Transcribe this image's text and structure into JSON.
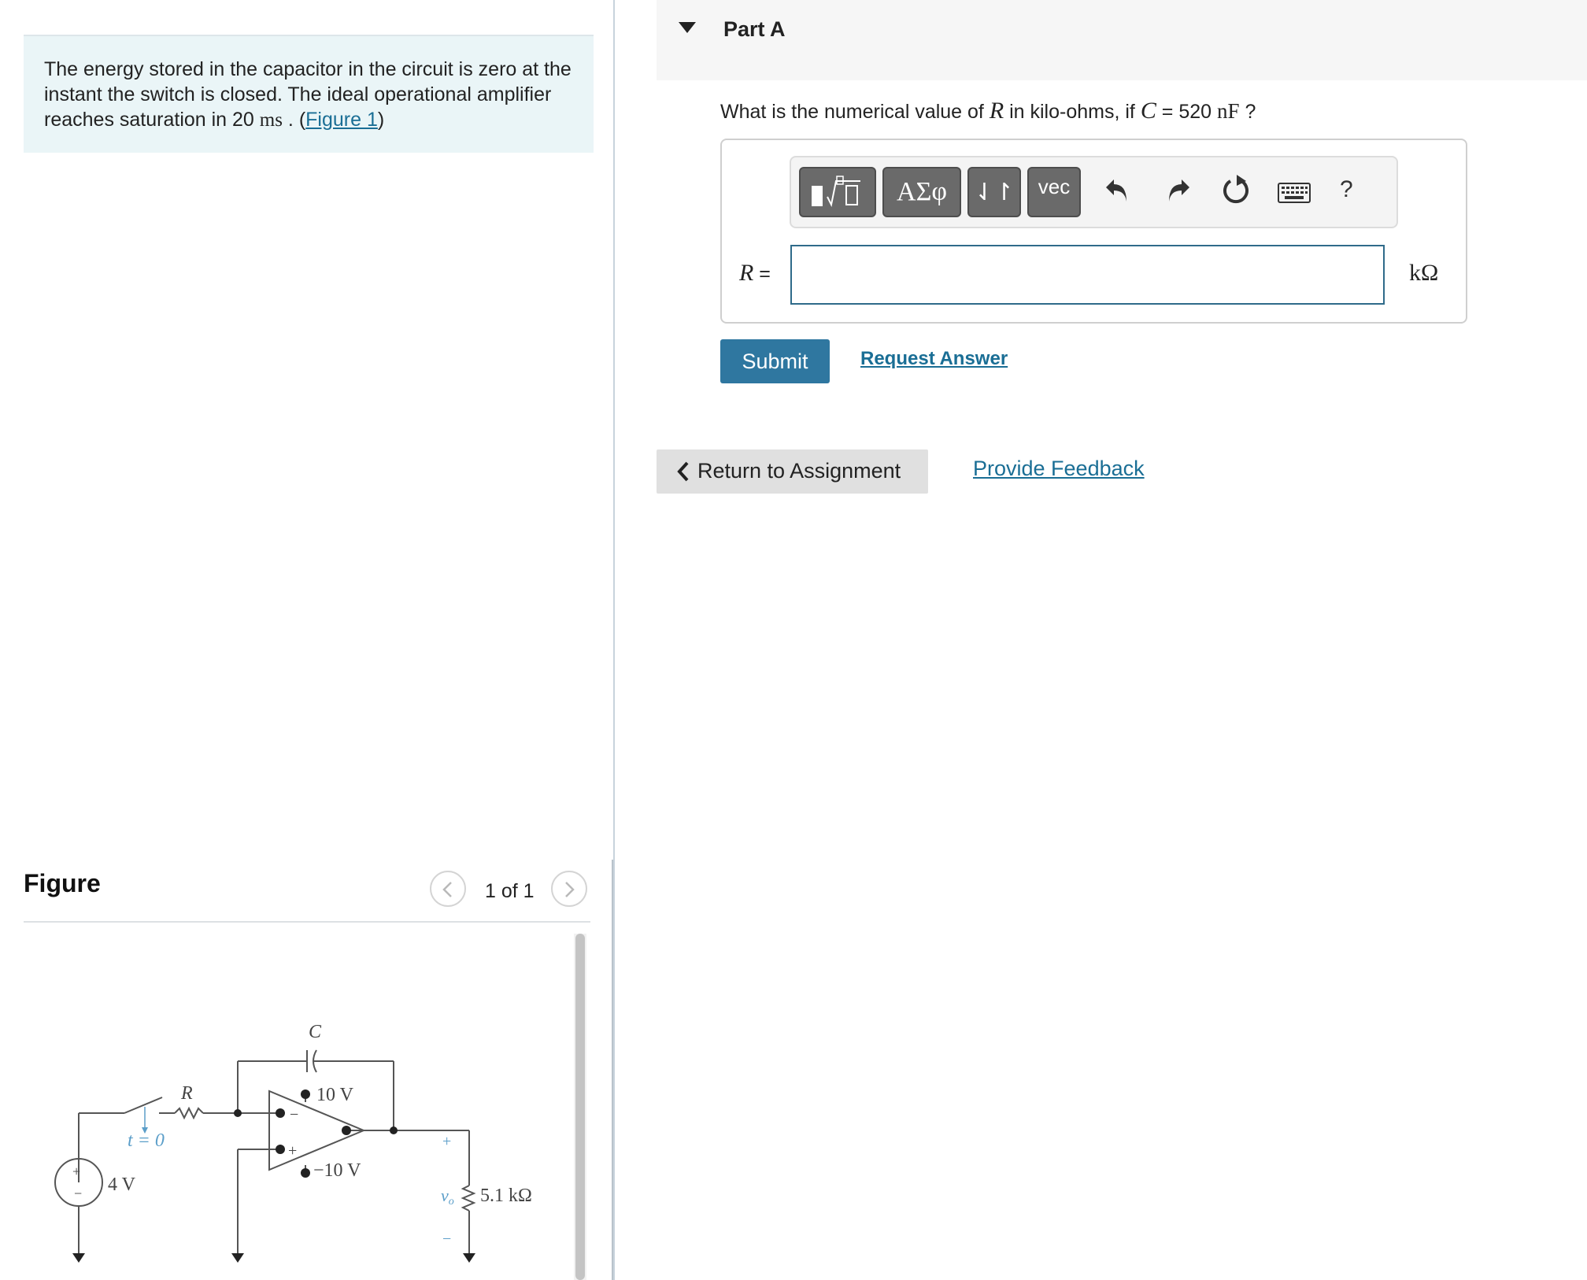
{
  "problem": {
    "text": "The energy stored in the capacitor in the circuit is zero at the instant the switch is closed. The ideal operational amplifier reaches saturation in 20",
    "time_unit": "ms",
    "text_after_unit": " . (",
    "figure_link": "Figure 1",
    "close_paren": ")"
  },
  "figure": {
    "title": "Figure",
    "counter": "1 of 1",
    "prev_icon": "chevron-left-icon",
    "next_icon": "chevron-right-icon",
    "circuit": {
      "capacitor_label": "C",
      "resistor_label": "R",
      "switch_label": "t = 0",
      "source_label": "4 V",
      "source_plus": "+",
      "source_minus": "−",
      "supply_positive": "10 V",
      "supply_negative": "−10 V",
      "opamp_minus": "−",
      "opamp_plus": "+",
      "output_label": "v",
      "output_subscript": "o",
      "output_plus": "+",
      "output_minus": "−",
      "load_label": "5.1 kΩ"
    }
  },
  "part": {
    "title": "Part A",
    "caret_icon": "caret-down-icon",
    "question_prefix": "What is the numerical value of ",
    "question_var": "R",
    "question_mid": " in kilo-ohms, if ",
    "question_var2": "C",
    "question_eq": " = 520 ",
    "question_unit": "nF",
    "question_suffix": " ?"
  },
  "toolbar": {
    "greek": "ΑΣφ",
    "arrows": "⇃↾",
    "vec": "vec",
    "help": "?",
    "icons": [
      "templates-icon",
      "undo-icon",
      "redo-icon",
      "reset-icon",
      "keyboard-icon"
    ]
  },
  "answer": {
    "variable": "R",
    "equals": " =",
    "value": "",
    "unit": "kΩ"
  },
  "actions": {
    "submit": "Submit",
    "request_answer": "Request Answer",
    "return": "Return to Assignment",
    "feedback": "Provide Feedback"
  },
  "colors": {
    "accent": "#2f77a0",
    "link": "#1a6e95",
    "intro_bg": "#eaf5f7",
    "toolbar_button": "#6a6a6a",
    "circuit_label_blue": "#5b9ec9"
  }
}
